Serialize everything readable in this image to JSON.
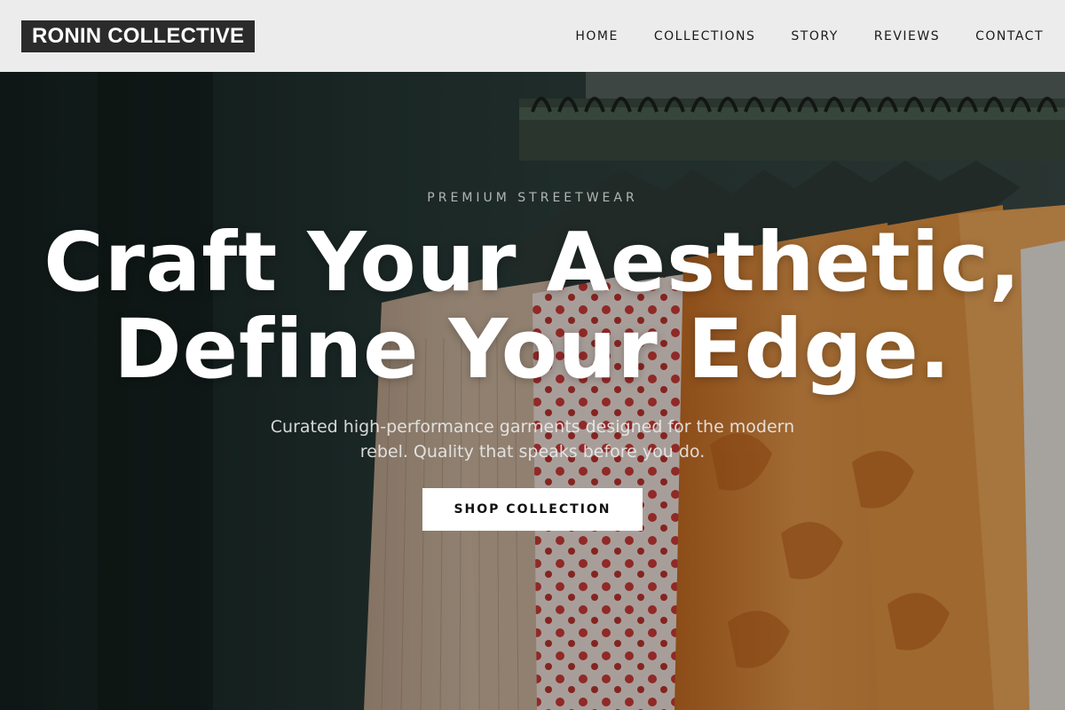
{
  "header": {
    "logo": "RONIN COLLECTIVE",
    "nav": [
      "HOME",
      "COLLECTIONS",
      "STORY",
      "REVIEWS",
      "CONTACT"
    ]
  },
  "hero": {
    "eyebrow": "PREMIUM STREETWEAR",
    "headline_line1": "Craft Your Aesthetic,",
    "headline_line2": "Define Your Edge.",
    "subtext": "Curated high-performance garments designed for the modern rebel. Quality that speaks before you do.",
    "cta_label": "SHOP COLLECTION",
    "image": "clothing-rack-photo"
  },
  "colors": {
    "header_bg": "#ececec",
    "logo_bg": "#2b2b2b",
    "cta_bg": "#ffffff",
    "wall_dark": "#1c2a28",
    "garment_orange": "#d9893a"
  }
}
